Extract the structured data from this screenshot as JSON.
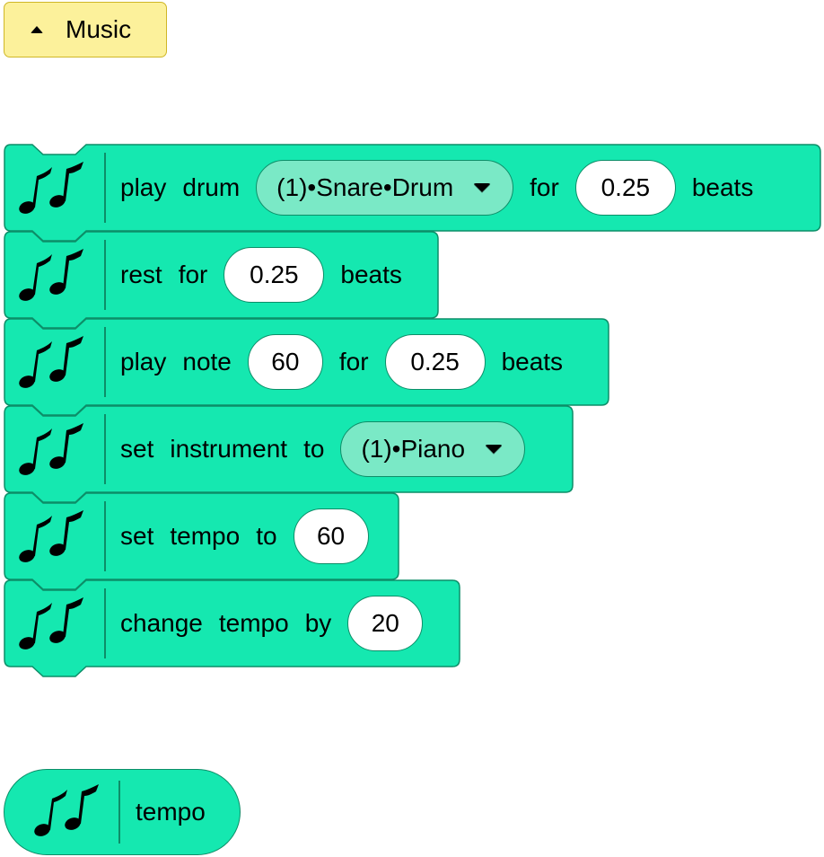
{
  "category": {
    "label": "Music",
    "icon": "caret-up-icon",
    "color": "#fcf19b"
  },
  "colors": {
    "block": "#15e8b0",
    "block_border": "#0d8e68",
    "dropdown": "#7ae9c6"
  },
  "blocks": {
    "play_drum": {
      "w1": "play",
      "w2": "drum",
      "drum": "(1)•Snare•Drum",
      "w3": "for",
      "beats_value": "0.25",
      "w4": "beats"
    },
    "rest": {
      "w1": "rest",
      "w2": "for",
      "beats_value": "0.25",
      "w3": "beats"
    },
    "play_note": {
      "w1": "play",
      "w2": "note",
      "note_value": "60",
      "w3": "for",
      "beats_value": "0.25",
      "w4": "beats"
    },
    "set_instrument": {
      "w1": "set",
      "w2": "instrument",
      "w3": "to",
      "instrument": "(1)•Piano"
    },
    "set_tempo": {
      "w1": "set",
      "w2": "tempo",
      "w3": "to",
      "tempo_value": "60"
    },
    "change_tempo": {
      "w1": "change",
      "w2": "tempo",
      "w3": "by",
      "change_value": "20"
    }
  },
  "reporter": {
    "label": "tempo",
    "icon": "music-notes-icon"
  }
}
